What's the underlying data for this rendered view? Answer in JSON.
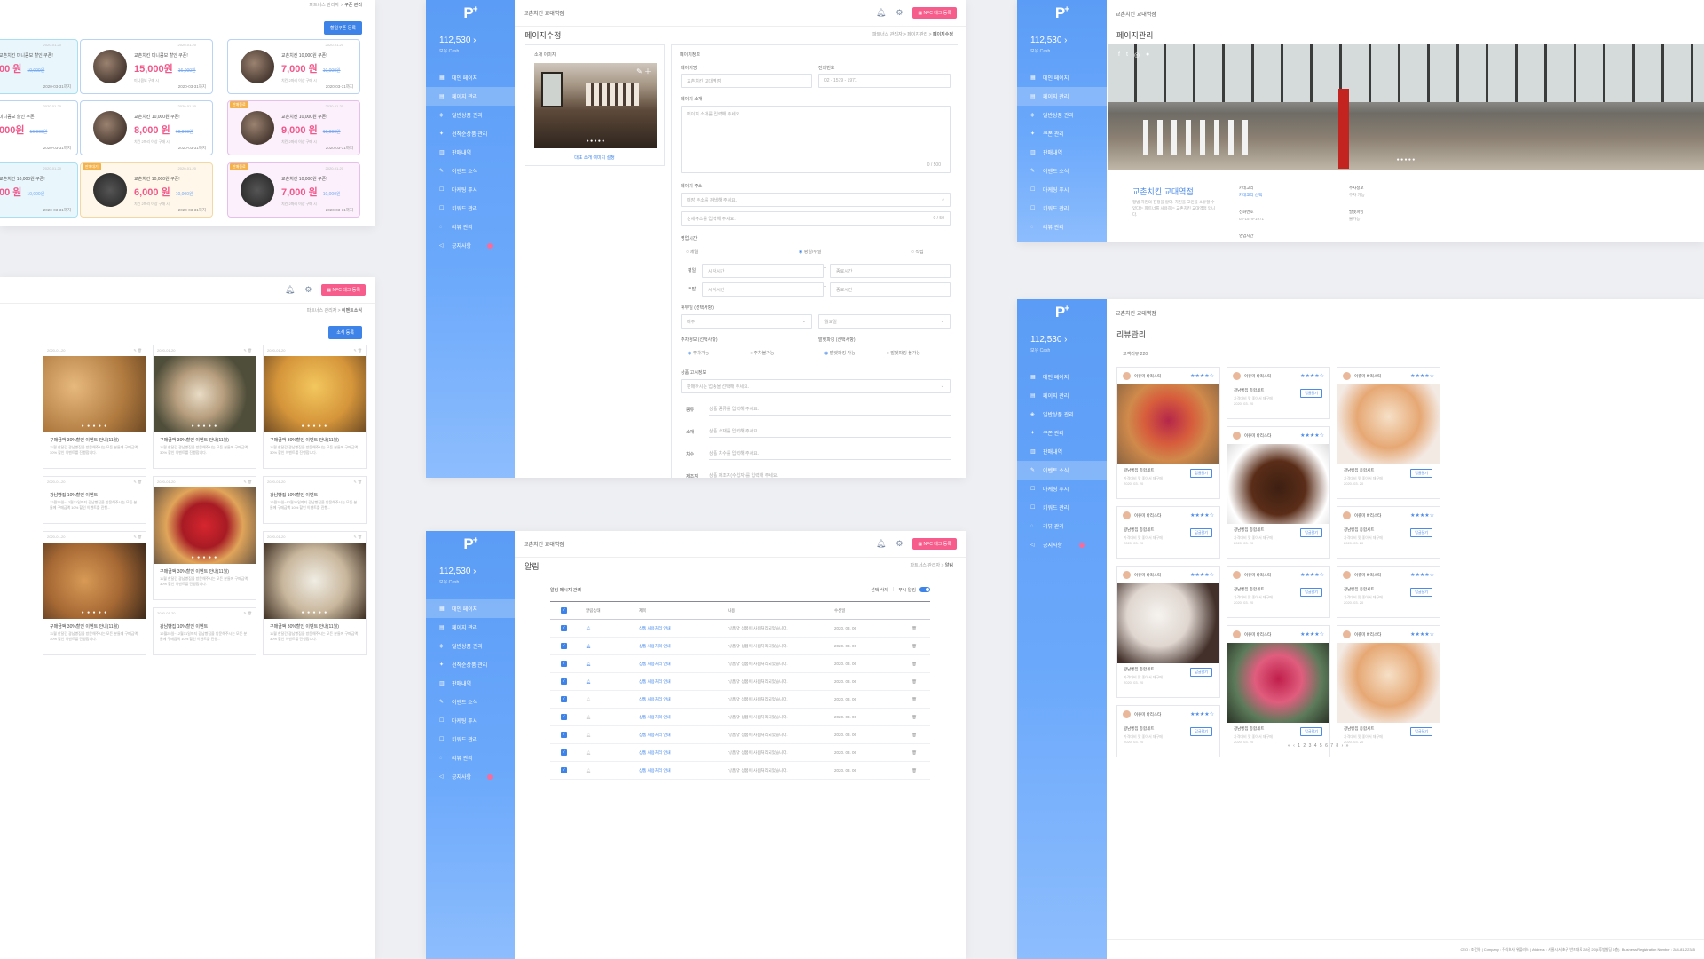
{
  "brand": {
    "logo": "P",
    "logo_sup": "+"
  },
  "shop_name": "교촌치킨 교대역점",
  "cash": {
    "amount": "112,530",
    "label": "보유 Cash"
  },
  "nfc_button": "NFC 태그 등록",
  "icons": {
    "bell": "bell-icon",
    "gear": "gear-icon",
    "trash": "trash-icon"
  },
  "colors": {
    "accent": "#5b9cf6",
    "pink": "#f75d8c"
  },
  "menu": [
    {
      "label": "메인 페이지",
      "icon": "▦"
    },
    {
      "label": "페이지 관리",
      "icon": "▤"
    },
    {
      "label": "일반상품 관리",
      "icon": "◈"
    },
    {
      "label": "선착순상품 관리",
      "icon": "✦"
    },
    {
      "label": "판매내역",
      "icon": "▥"
    },
    {
      "label": "이벤트 소식",
      "icon": "✎"
    },
    {
      "label": "마케팅 푸시",
      "icon": "☐"
    },
    {
      "label": "키워드 관리",
      "icon": "☐"
    },
    {
      "label": "리뷰 관리",
      "icon": "◌"
    },
    {
      "label": "공지사항",
      "icon": "◁"
    }
  ],
  "menu_alt": [
    {
      "label": "메인 페이지",
      "icon": "▦"
    },
    {
      "label": "페이지 관리",
      "icon": "▤"
    },
    {
      "label": "일반상품 관리",
      "icon": "◈"
    },
    {
      "label": "쿠폰 관리",
      "icon": "✦"
    },
    {
      "label": "판매내역",
      "icon": "▥"
    },
    {
      "label": "이벤트 소식",
      "icon": "✎"
    },
    {
      "label": "마케팅 푸시",
      "icon": "☐"
    },
    {
      "label": "키워드 관리",
      "icon": "☐"
    },
    {
      "label": "리뷰 관리",
      "icon": "◌"
    },
    {
      "label": "공지사항",
      "icon": "◁"
    }
  ],
  "coupon_page": {
    "breadcrumb": [
      "파트너스 관리자",
      "쿠폰 관리"
    ],
    "add_button": "할일쿠폰 등록",
    "coupons": [
      {
        "title": "교촌치킨 미니콤보 할인 쿠폰!",
        "price": "00 원",
        "orig": "10,000원",
        "note": "",
        "date": "2020-03-31까지",
        "dt": "2020-01-20",
        "tag": "",
        "style": "b",
        "dark": false
      },
      {
        "title": "교촌치킨 미니콤보 할인 쿠폰!",
        "price": "15,000원",
        "orig": "16,000원",
        "note": "미니콤보 구매 시",
        "date": "2020-03-31까지",
        "dt": "2020-01-20",
        "tag": "",
        "style": "",
        "dark": false
      },
      {
        "title": "교촌치킨 10,000원 쿠폰!",
        "price": "7,000 원",
        "orig": "10,000원",
        "note": "치킨 2마리 이상 구매 시",
        "date": "2020-03-31까지",
        "dt": "2020-01-20",
        "tag": "",
        "style": "",
        "dark": false
      },
      {
        "title": "미니콤보 할인 쿠폰!",
        "price": "000원",
        "orig": "16,000원",
        "note": "",
        "date": "2020-03-31까지",
        "dt": "2020-01-20",
        "tag": "",
        "style": "",
        "dark": false
      },
      {
        "title": "교촌치킨 10,000원 쿠폰!",
        "price": "8,000 원",
        "orig": "10,000원",
        "note": "치킨 2마리 이상 구매 시",
        "date": "2020-03-31까지",
        "dt": "2020-01-20",
        "tag": "",
        "style": "",
        "dark": false
      },
      {
        "title": "교촌치킨 10,000원 쿠폰!",
        "price": "9,000 원",
        "orig": "10,000원",
        "note": "치킨 2마리 이상 구매 시",
        "date": "2020-03-31까지",
        "dt": "2020-01-20",
        "tag": "판매종료",
        "style": "p",
        "dark": false
      },
      {
        "title": "교촌치킨 10,000원 쿠폰!",
        "price": "00 원",
        "orig": "10,000원",
        "note": "",
        "date": "2020-03-31까지",
        "dt": "2020-01-20",
        "tag": "",
        "style": "b",
        "dark": false
      },
      {
        "title": "교촌치킨 10,000원 쿠폰!",
        "price": "6,000 원",
        "orig": "10,000원",
        "note": "치킨 2마리 이상 구매 시",
        "date": "2020-03-31까지",
        "dt": "2020-01-20",
        "tag": "판매대기",
        "style": "y",
        "dark": true
      },
      {
        "title": "교촌치킨 10,000원 쿠폰!",
        "price": "7,000 원",
        "orig": "10,000원",
        "note": "치킨 2마리 이상 구매 시",
        "date": "2020-03-31까지",
        "dt": "2020-01-20",
        "tag": "판매종료",
        "style": "p",
        "dark": true
      }
    ]
  },
  "event_page": {
    "breadcrumb": [
      "파트너스 관리자",
      "이벤트소식"
    ],
    "add_button": "소식 등록",
    "date": "2020-01-20",
    "dots": "● ● ● ● ●",
    "cards": [
      {
        "title": "구매금액 30%할인 이벤트 안내(11월)",
        "desc": "11월 한달간 광남빵집을 방문해주시는 모든 분들께 구매금액 30% 할인 이벤트를 진행합니다.",
        "img": "fbrd"
      },
      {
        "title": "구매금액 30%할인 이벤트 안내(11월)",
        "desc": "11월 한달간 광남빵집을 방문해주시는 모든 분들께 구매금액 30% 할인 이벤트를 진행합니다.",
        "img": "fcof"
      },
      {
        "title": "구매금액 30%할인 이벤트 안내(11월)",
        "desc": "11월 한달간 광남빵집을 방문해주시는 모든 분들께 구매금액 30% 할인 이벤트를 진행합니다.",
        "img": "fegg"
      },
      {
        "title": "광남빵집 10%할인 이벤트",
        "desc": "12월25일~12월31일까지 광남빵집을 방문해주시는 모든 분들께 구매금액 10% 할인 이벤트를 진행...",
        "img": ""
      },
      {
        "title": "구매금액 30%할인 이벤트 안내(11월)",
        "desc": "11월 한달간 광남빵집을 방문해주시는 모든 분들께 구매금액 30% 할인 이벤트를 진행합니다.",
        "img": "ftart"
      },
      {
        "title": "광남빵집 10%할인 이벤트",
        "desc": "12월25일~12월31일까지 광남빵집을 방문해주시는 모든 분들께 구매금액 10% 할인 이벤트를 진행...",
        "img": ""
      },
      {
        "title": "구매금액 30%할인 이벤트 안내(11월)",
        "desc": "11월 한달간 광남빵집을 방문해주시는 모든 분들께 구매금액 30% 할인 이벤트를 진행합니다.",
        "img": "fcro"
      },
      {
        "title": "광남빵집 10%할인 이벤트",
        "desc": "12월25일~12월31일까지 광남빵집을 방문해주시는 모든 분들께 구매금액 10% 할인 이벤트를 진행...",
        "img": ""
      },
      {
        "title": "구매금액 30%할인 이벤트 안내(11월)",
        "desc": "11월 한달간 광남빵집을 방문해주시는 모든 분들께 구매금액 30% 할인 이벤트를 진행합니다.",
        "img": "fcake"
      }
    ]
  },
  "edit_page": {
    "title": "페이지수정",
    "breadcrumb": [
      "파트너스 관리자",
      "페이지관리",
      "페이지수정"
    ],
    "intro_label": "소개 이미지",
    "intro_link": "대표 소개 이미지 설정",
    "info_title": "페이지정보",
    "name_label": "페이지명",
    "name_value": "교촌치킨 교대역점",
    "phone_label": "전화번호",
    "phone_value": "02 - 1579 - 1971",
    "desc_label": "페이지 소개",
    "desc_placeholder": "페이지 소개를 입력해 주세요.",
    "desc_counter": "0 / 500",
    "addr_label": "페이지 주소",
    "addr_ph1": "매장 주소를 검색해 주세요.",
    "addr_ph2": "상세주소를 입력해 주세요.",
    "addr_counter": "0 / 50",
    "hours_label": "영업시간",
    "hours_opts": [
      "매일",
      "평일/주말",
      "직접"
    ],
    "weekday": "평일",
    "weekend": "주말",
    "start_ph": "시작시간",
    "end_ph": "종료시간",
    "holiday_label": "휴무일 (선택사항)",
    "holiday1": "매주",
    "holiday2": "월요일",
    "parking_label": "주차정보 (선택사항)",
    "parking_opts": [
      "주차가능",
      "주차불가능"
    ],
    "valet_label": "발렛파킹 (선택사항)",
    "valet_opts": [
      "발렛파킹 가능",
      "발렛파킹 불가능"
    ],
    "notice_label": "상품 고시정보",
    "notice_ph": "판매하시는 업종을 선택해 주세요.",
    "fields": [
      {
        "label": "종류",
        "ph": "상품 종류를 입력해 주세요."
      },
      {
        "label": "소재",
        "ph": "상품 소재를 입력해 주세요."
      },
      {
        "label": "치수",
        "ph": "상품 치수를 입력해 주세요."
      },
      {
        "label": "제조자",
        "ph": "상품 제조자(수입자)를 입력해 주세요."
      }
    ]
  },
  "alarm_page": {
    "title": "알림",
    "breadcrumb": [
      "파트너스 관리자",
      "알림"
    ],
    "section": "알림 메시지 관리",
    "actions": [
      "선택 삭제",
      "푸시 알림"
    ],
    "headers": [
      "알림상태",
      "제목",
      "내용",
      "수신일"
    ],
    "rows": [
      {
        "title": "상품 사용처리 안내",
        "content": "'상품명' 상품이 사용처리되었습니다.",
        "date": "2020. 03. 06"
      },
      {
        "title": "상품 사용처리 안내",
        "content": "'상품명' 상품이 사용처리되었습니다.",
        "date": "2020. 03. 06"
      },
      {
        "title": "상품 사용처리 안내",
        "content": "'상품명' 상품이 사용처리되었습니다.",
        "date": "2020. 03. 06"
      },
      {
        "title": "상품 사용처리 안내",
        "content": "'상품명' 상품이 사용처리되었습니다.",
        "date": "2020. 03. 06"
      },
      {
        "title": "상품 사용처리 안내",
        "content": "'상품명' 상품이 사용처리되었습니다.",
        "date": "2020. 03. 06"
      },
      {
        "title": "상품 사용처리 안내",
        "content": "'상품명' 상품이 사용처리되었습니다.",
        "date": "2020. 03. 06"
      },
      {
        "title": "상품 사용처리 안내",
        "content": "'상품명' 상품이 사용처리되었습니다.",
        "date": "2020. 03. 06"
      },
      {
        "title": "상품 사용처리 안내",
        "content": "'상품명' 상품이 사용처리되었습니다.",
        "date": "2020. 03. 06"
      },
      {
        "title": "상품 사용처리 안내",
        "content": "'상품명' 상품이 사용처리되었습니다.",
        "date": "2020. 03. 06"
      }
    ]
  },
  "pagemgr": {
    "title": "페이지관리",
    "shop_title": "교촌치킨 교대역점",
    "shop_desc": "평범 치킨의 진정을 알다. 치킨을 고민을 소유할 수 있다는 파트너를 사용하는 교촌치킨 교대역점 입니다.",
    "col1": {
      "label": "카테고리",
      "value": "카테고리 선택"
    },
    "col1b": {
      "label": "전화번호",
      "value": "02-1579-1971"
    },
    "col1c": {
      "label": "영업시간"
    },
    "col2": {
      "label": "주차정보",
      "value": "주차 가능"
    },
    "col2b": {
      "label": "발렛파킹",
      "value": "불가능"
    },
    "social": [
      "f",
      "t",
      "◎",
      "●"
    ]
  },
  "review": {
    "title": "리뷰관리",
    "count_label": "고객리뷰",
    "count": "220",
    "user": "이쥬미 바리스타",
    "stars": "★★★★☆",
    "reply_btn": "답글달기",
    "item": "광남빵집 종합세트",
    "comment": "가격대비 맛 좋아서 재구매",
    "date": "2020. 03. 20",
    "pagination": "« ‹ 1 2 3 4 5 6 7 8 › »",
    "footer": "CEO : 조건아 | Company : 주식회사 위플러스 | Address : 서울시 서초구 반포대로 28길 20(#후방빌딩 6층) | Business Registration Number : 284-81-22345"
  }
}
